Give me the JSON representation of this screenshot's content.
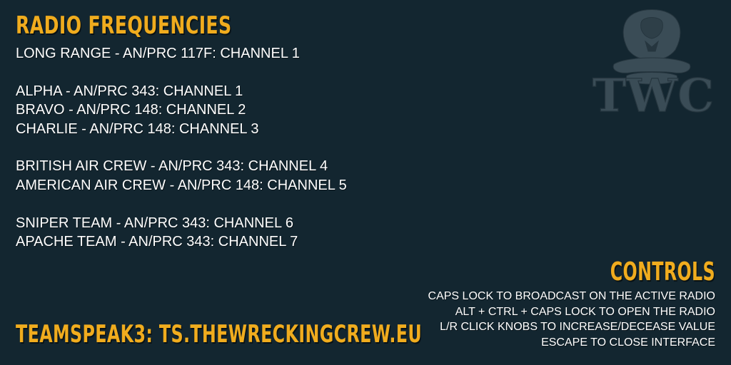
{
  "title": "RADIO FREQUENCIES",
  "frequencies": [
    {
      "text": "LONG RANGE - AN/PRC 117F: CHANNEL 1"
    },
    {
      "text": "ALPHA - AN/PRC 343: CHANNEL 1"
    },
    {
      "text": "BRAVO - AN/PRC 148: CHANNEL 2"
    },
    {
      "text": "CHARLIE - AN/PRC 148: CHANNEL 3"
    },
    {
      "text": "BRITISH AIR CREW - AN/PRC 343: CHANNEL 4"
    },
    {
      "text": "AMERICAN AIR CREW - AN/PRC 148: CHANNEL 5"
    },
    {
      "text": "SNIPER TEAM - AN/PRC 343: CHANNEL 6"
    },
    {
      "text": "APACHE TEAM - AN/PRC 343: CHANNEL 7"
    }
  ],
  "controls": {
    "title": "CONTROLS",
    "lines": [
      "CAPS LOCK TO BROADCAST ON THE ACTIVE RADIO",
      "ALT + CTRL + CAPS LOCK TO OPEN THE RADIO",
      "L/R CLICK KNOBS TO INCREASE/DECEASE VALUE",
      "ESCAPE TO CLOSE INTERFACE"
    ]
  },
  "teamspeak": "TEAMSPEAK3: TS.THEWRECKINGCREW.EU",
  "logo": {
    "text": "TWC",
    "icon": "cobra-crest-icon"
  },
  "colors": {
    "background": "#132630",
    "accent": "#f0ac1e",
    "body_text": "#ffffff",
    "logo": "#3a4c56"
  }
}
